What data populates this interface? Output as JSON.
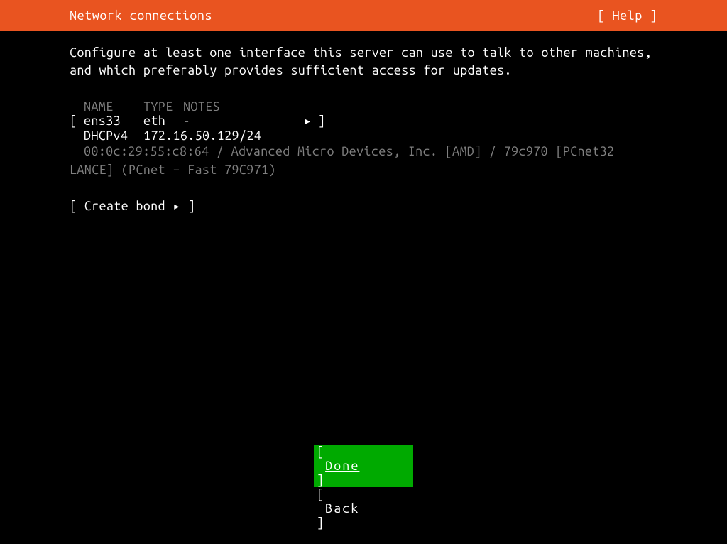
{
  "header": {
    "title": "Network connections",
    "help": "[ Help ]"
  },
  "description": "Configure at least one interface this server can use to talk to other machines, and which preferably provides sufficient access for updates.",
  "table": {
    "headers": {
      "name": "NAME",
      "type": "TYPE",
      "notes": "NOTES"
    }
  },
  "interface": {
    "open_bracket": "[",
    "name": "ens33",
    "type": "eth",
    "notes": "-",
    "arrow": "▸",
    "close_bracket": "]",
    "dhcp_label": "DHCPv4",
    "dhcp_value": "172.16.50.129/24",
    "hw_line1": "00:0c:29:55:c8:64 / Advanced Micro Devices, Inc. [AMD] / 79c970 [PCnet32",
    "hw_line2": "LANCE] (PCnet – Fast 79C971)"
  },
  "create_bond": "[ Create bond ▸ ]",
  "buttons": {
    "done": {
      "open": "[",
      "label": "Done",
      "close": "]"
    },
    "back": {
      "open": "[",
      "label": "Back",
      "close": "]"
    }
  }
}
